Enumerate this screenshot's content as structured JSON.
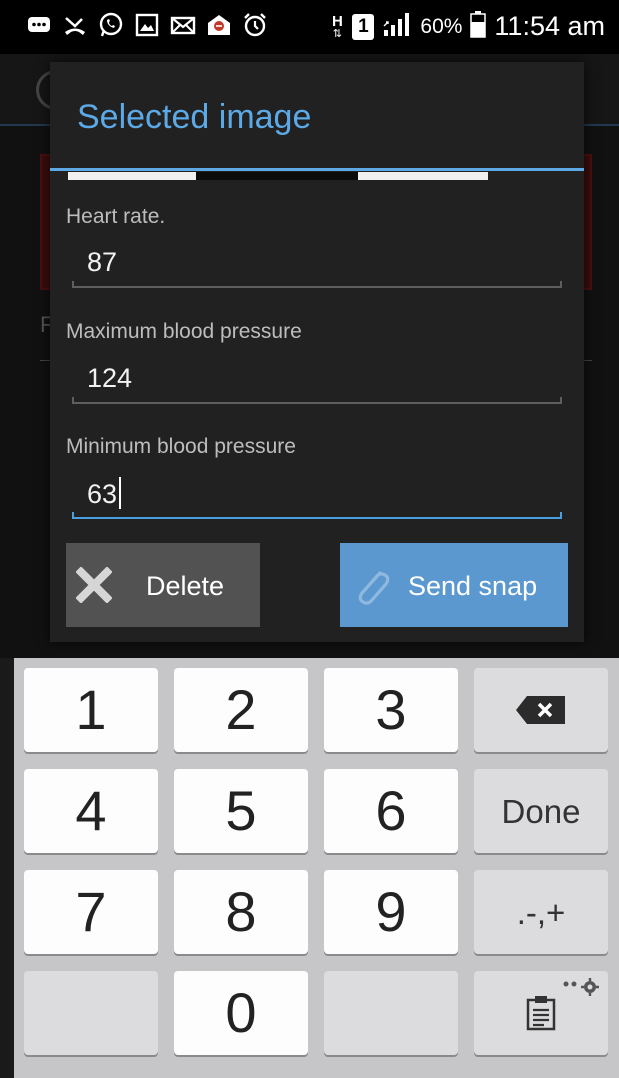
{
  "status_bar": {
    "icons": [
      "message-icon",
      "missed-call-icon",
      "whatsapp-icon",
      "gallery-icon",
      "mail-icon",
      "inbox-icon",
      "alarm-icon",
      "hspa-icon",
      "sim-icon",
      "signal-icon",
      "battery-icon"
    ],
    "network_type": "H",
    "sim_label": "1",
    "battery_percent": "60%",
    "time": "11:54 am"
  },
  "dialog": {
    "title": "Selected image",
    "fields": [
      {
        "label": "Heart rate.",
        "value": "87"
      },
      {
        "label": "Maximum blood pressure",
        "value": "124"
      },
      {
        "label": "Minimum blood pressure",
        "value": "63"
      }
    ],
    "delete_label": "Delete",
    "send_label": "Send snap"
  },
  "keyboard": {
    "rows": [
      [
        "1",
        "2",
        "3",
        "backspace"
      ],
      [
        "4",
        "5",
        "6",
        "Done"
      ],
      [
        "7",
        "8",
        "9",
        ".-,+"
      ],
      [
        "",
        "0",
        "",
        "clipboard"
      ]
    ],
    "done_label": "Done",
    "symbols_label": ".-,+"
  },
  "colors": {
    "accent": "#5ca9e6",
    "send_button": "#5a98cf",
    "delete_button": "#525252",
    "dialog_bg": "#212121"
  }
}
